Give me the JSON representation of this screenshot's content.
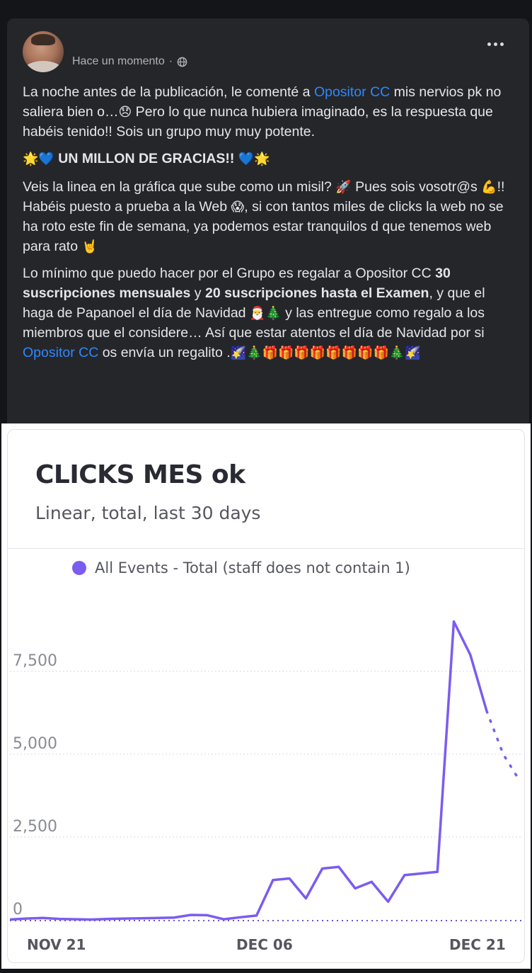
{
  "post": {
    "author_name": "",
    "timestamp": "Hace un momento",
    "separator": "·",
    "privacy_icon": "globe-icon",
    "more_icon": "more-horizontal-icon",
    "paragraphs": {
      "p1": {
        "t1": "La noche antes de la publicación, le comenté a ",
        "link": "Opositor CC",
        "t2": " mis nervios pk no saliera bien o…",
        "e1": "😞",
        "t3": " Pero lo que nunca hubiera imaginado, es la respuesta que habéis tenido!! Sois un grupo muy muy potente."
      },
      "p2": {
        "e1": "🌟💙",
        "text": " UN MILLON DE GRACIAS!! ",
        "e2": "💙🌟"
      },
      "p3": {
        "t1": "Veis la linea en la gráfica que sube como un misil? ",
        "e1": "🚀",
        "t2": " Pues sois vosotr@s ",
        "e2": "💪",
        "t3": "!! Habéis puesto a prueba a la Web ",
        "e3": "😱",
        "t4": ", si con tantos miles de clicks la web no se ha roto este fin de semana, ya podemos estar tranquilos d que tenemos web para rato ",
        "e4": "🤘"
      },
      "p4": {
        "t1": "Lo mínimo que puedo hacer por el Grupo es regalar a Opositor CC ",
        "b1": "30 suscripciones mensuales",
        "t2": " y ",
        "b2": "20 suscripciones hasta el Examen",
        "t3": ", y que el haga de Papanoel el día de Navidad ",
        "e1": "🎅🎄",
        "t4": " y las entregue como regalo a los miembros que el considere… Así que estar atentos el día de Navidad por si ",
        "link": "Opositor CC",
        "t5": " os envía un regalito .",
        "e2": "🌠🎄🎁🎁🎁🎁🎁🎁🎁🎁🎄🌠"
      }
    }
  },
  "chart_data": {
    "type": "line",
    "title": "CLICKS MES ok",
    "subtitle": "Linear, total, last 30 days",
    "legend": [
      "All Events - Total (staff does not contain 1)"
    ],
    "legend_position": "top",
    "series_color": "#7b5cf0",
    "grid": true,
    "x_tick_labels": [
      "NOV 21",
      "DEC 06",
      "DEC 21"
    ],
    "x_range": [
      "Nov 21",
      "Dec 23"
    ],
    "y_tick_labels": [
      "0",
      "2,500",
      "5,000",
      "7,500"
    ],
    "y_ticks": [
      0,
      2500,
      5000,
      7500
    ],
    "ylim": [
      0,
      9500
    ],
    "series": [
      {
        "name": "All Events - Total (staff does not contain 1)",
        "x": [
          "Nov 21",
          "Nov 22",
          "Nov 23",
          "Nov 24",
          "Nov 25",
          "Nov 26",
          "Nov 27",
          "Nov 28",
          "Nov 29",
          "Nov 30",
          "Dec 01",
          "Dec 02",
          "Dec 03",
          "Dec 04",
          "Dec 05",
          "Dec 06",
          "Dec 07",
          "Dec 08",
          "Dec 09",
          "Dec 10",
          "Dec 11",
          "Dec 12",
          "Dec 13",
          "Dec 14",
          "Dec 15",
          "Dec 16",
          "Dec 17",
          "Dec 18",
          "Dec 19",
          "Dec 20",
          "Dec 21",
          "Dec 22"
        ],
        "values": [
          10,
          40,
          60,
          30,
          20,
          10,
          30,
          40,
          50,
          60,
          70,
          150,
          140,
          20,
          80,
          130,
          1200,
          1250,
          650,
          1550,
          1600,
          950,
          1150,
          550,
          1350,
          1400,
          1450,
          9000,
          8000,
          6300,
          5000,
          4200
        ],
        "partial_from_index": 29
      },
      {
        "name": "",
        "line_style": "dotted",
        "values_constant": 0
      }
    ]
  }
}
